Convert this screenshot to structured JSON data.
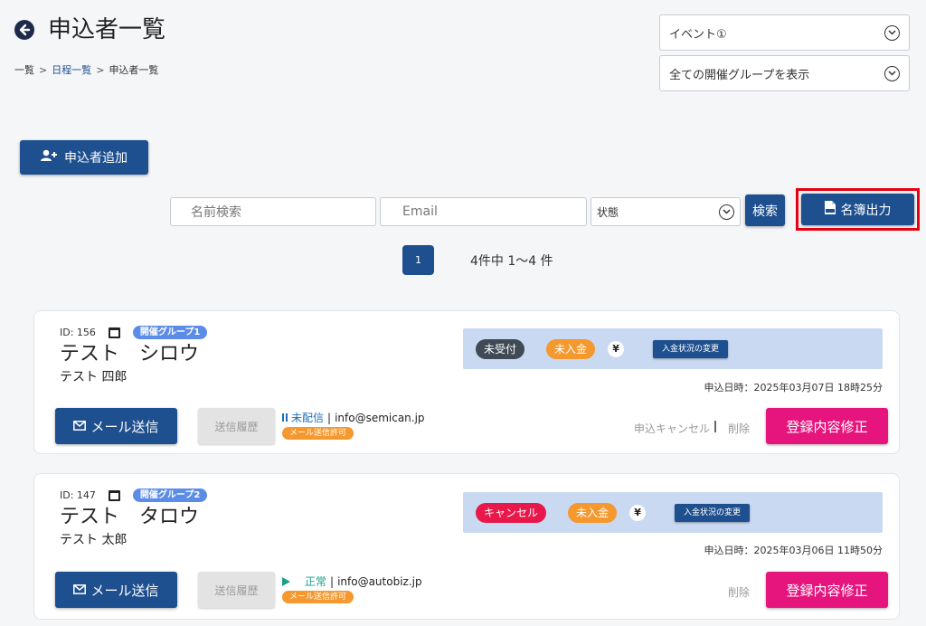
{
  "header": {
    "title": "申込者一覧",
    "breadcrumb": [
      "一覧",
      "日程一覧",
      "申込者一覧"
    ],
    "breadcrumb_sep": ">",
    "event_select": "イベント①",
    "group_select": "全ての開催グループを表示"
  },
  "toolbar": {
    "add_label": "申込者追加",
    "name_placeholder": "名前検索",
    "email_placeholder": "Email",
    "state_label": "状態",
    "search_label": "検索",
    "export_label": "名簿出力"
  },
  "pagination": {
    "current": "1",
    "summary": "4件中 1〜4 件"
  },
  "applicants": [
    {
      "id": "ID: 156",
      "group": "開催グループ1",
      "name_kana": "テスト　シロウ",
      "name_kanji": "テスト 四郎",
      "reception": "未受付",
      "payment": "未入金",
      "yen": "¥",
      "change_label": "入金状況の変更",
      "applied_at": "申込日時：2025年03月07日 18時25分",
      "mail_label": "メール送信",
      "history_label": "送信履歴",
      "mail_status": "未配信",
      "mail_sep": "|",
      "email": "info@semican.jp",
      "permit": "メール送信許可",
      "cancel_label": "申込キャンセル",
      "delete_label": "削除",
      "edit_label": "登録内容修正"
    },
    {
      "id": "ID: 147",
      "group": "開催グループ2",
      "name_kana": "テスト　タロウ",
      "name_kanji": "テスト 太郎",
      "reception": "キャンセル",
      "payment": "未入金",
      "yen": "¥",
      "change_label": "入金状況の変更",
      "applied_at": "申込日時：2025年03月06日 11時50分",
      "mail_label": "メール送信",
      "history_label": "送信履歴",
      "mail_status": "正常",
      "mail_sep": "|",
      "email": "info@autobiz.jp",
      "permit": "メール送信許可",
      "delete_label": "削除",
      "edit_label": "登録内容修正"
    }
  ],
  "colors": {
    "primary": "#1e4f8e",
    "accent_pink": "#e6157e",
    "badge_orange": "#f5982e",
    "badge_red": "#e8184b",
    "status_panel": "#c9d9f2",
    "highlight_border": "#e60012"
  }
}
